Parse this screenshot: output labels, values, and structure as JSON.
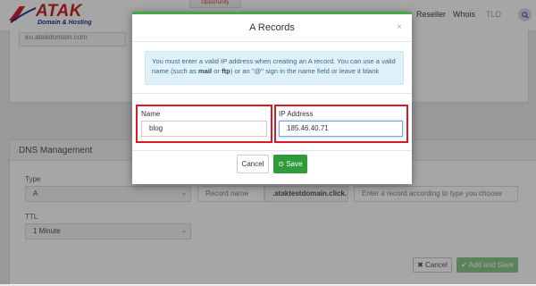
{
  "brand": {
    "name": "ATAK",
    "tagline": "Domain & Hosting"
  },
  "top_tab": "Opportunity",
  "nav": {
    "reseller": "Reseller",
    "whois": "Whois",
    "tld": "TLD"
  },
  "domain_field": "eu.atakdomain.com",
  "dns": {
    "title": "DNS Management",
    "type_label": "Type",
    "type_value": "A",
    "ttl_label": "TTL",
    "ttl_value": "1 Minute",
    "record_name_placeholder": "Record name",
    "domain_suffix": ".ataktestdomain.click.",
    "value_placeholder": "Enter a record according to type you choose",
    "cancel_label": "Cancel",
    "add_save_label": "Add and Save"
  },
  "modal": {
    "title": "A Records",
    "close": "×",
    "info_pre": "You must enter a valid IP address when creating an A record. You can use a valid name (such as ",
    "info_mail": "mail",
    "info_or": " or ",
    "info_ftp": "ftp",
    "info_post": ") or an \"@\" sign in the name field or leave it blank",
    "name_label": "Name",
    "name_value": "blog",
    "ip_label": "IP Address",
    "ip_value": "185.46.40.71",
    "cancel_label": "Cancel",
    "save_label": "Save"
  },
  "colors": {
    "accent": "#2f9c3c",
    "highlight": "#d91c24",
    "info_bg": "#dff0f8"
  }
}
